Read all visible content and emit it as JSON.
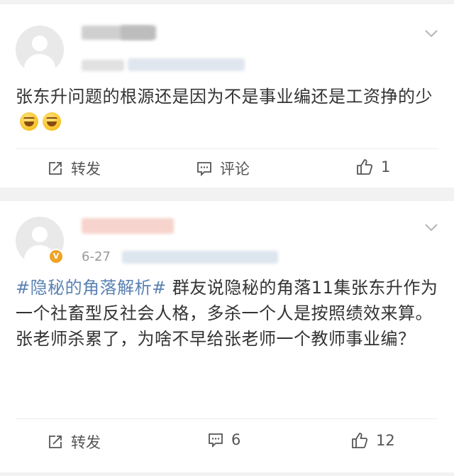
{
  "posts": [
    {
      "text": "张东升问题的根源还是因为不是事业编还是工资挣的少",
      "emoji_names": [
        "laugh-cry-icon",
        "laugh-cry-icon"
      ],
      "actions": {
        "repost": "转发",
        "comment": "评论",
        "like": "1"
      }
    },
    {
      "date": "6-27",
      "hashtag": "#隐秘的角落解析#",
      "text_line1": " 群友说隐秘的角落11集张东升作为一个社畜型反社会人格，多杀一个人是按照绩效来算。",
      "text_line2": "张老师杀累了，为啥不早给张老师一个教师事业编？",
      "actions": {
        "repost": "转发",
        "comment": "6",
        "like": "12"
      }
    }
  ],
  "colors": {
    "hashtag": "#5a82b3",
    "badge": "#f1a325",
    "background": "#f2f2f2"
  }
}
